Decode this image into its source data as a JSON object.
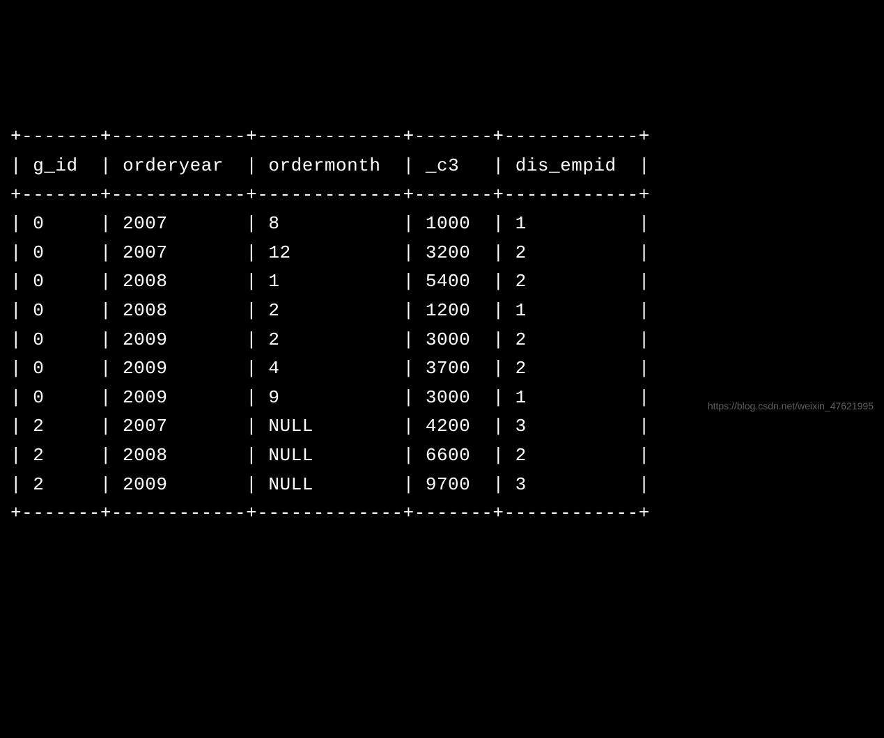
{
  "table": {
    "columns": [
      "g_id",
      "orderyear",
      "ordermonth",
      "_c3",
      "dis_empid"
    ],
    "rows": [
      {
        "g_id": "0",
        "orderyear": "2007",
        "ordermonth": "8",
        "_c3": "1000",
        "dis_empid": "1"
      },
      {
        "g_id": "0",
        "orderyear": "2007",
        "ordermonth": "12",
        "_c3": "3200",
        "dis_empid": "2"
      },
      {
        "g_id": "0",
        "orderyear": "2008",
        "ordermonth": "1",
        "_c3": "5400",
        "dis_empid": "2"
      },
      {
        "g_id": "0",
        "orderyear": "2008",
        "ordermonth": "2",
        "_c3": "1200",
        "dis_empid": "1"
      },
      {
        "g_id": "0",
        "orderyear": "2009",
        "ordermonth": "2",
        "_c3": "3000",
        "dis_empid": "2"
      },
      {
        "g_id": "0",
        "orderyear": "2009",
        "ordermonth": "4",
        "_c3": "3700",
        "dis_empid": "2"
      },
      {
        "g_id": "0",
        "orderyear": "2009",
        "ordermonth": "9",
        "_c3": "3000",
        "dis_empid": "1"
      },
      {
        "g_id": "2",
        "orderyear": "2007",
        "ordermonth": "NULL",
        "_c3": "4200",
        "dis_empid": "3"
      },
      {
        "g_id": "2",
        "orderyear": "2008",
        "ordermonth": "NULL",
        "_c3": "6600",
        "dis_empid": "2"
      },
      {
        "g_id": "2",
        "orderyear": "2009",
        "ordermonth": "NULL",
        "_c3": "9700",
        "dis_empid": "3"
      }
    ]
  },
  "borders": {
    "divider": "+-------+------------+-------------+-------+------------+"
  },
  "watermark": "https://blog.csdn.net/weixin_47621995"
}
